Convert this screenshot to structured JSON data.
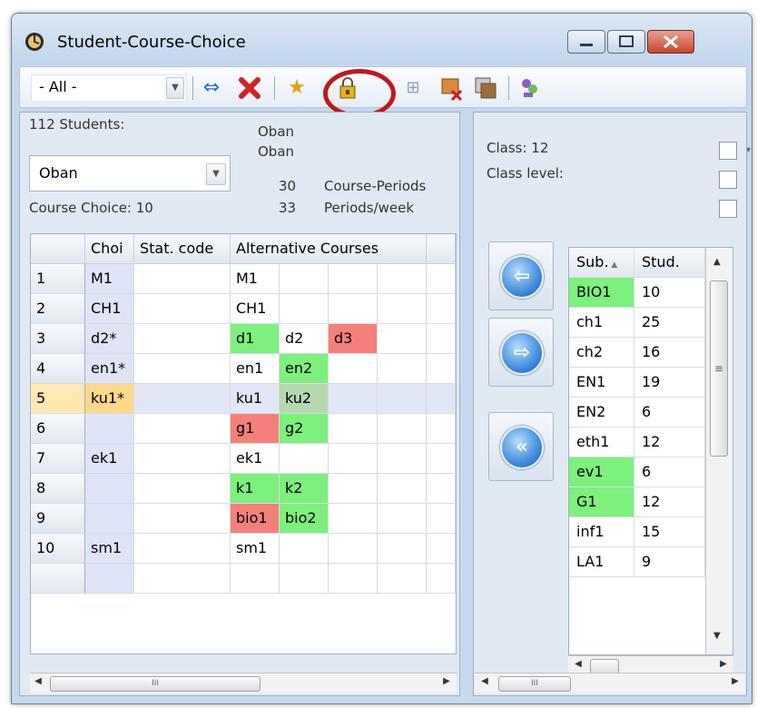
{
  "window": {
    "title": "Student-Course-Choice"
  },
  "toolbar": {
    "filter_value": "- All -",
    "icons": [
      "swap-arrows-icon",
      "delete-x-icon",
      "star-icon",
      "lock-icon",
      "grid-move-icon",
      "remove-course-icon",
      "copy-icon",
      "users-icon"
    ]
  },
  "left": {
    "students_label": "112 Students:",
    "student_name_1": "Oban",
    "student_name_2": "Oban",
    "student_value": "Oban",
    "course_periods_num": "30",
    "course_periods_label": "Course-Periods",
    "course_choice_label": "Course Choice: 10",
    "periods_week_num": "33",
    "periods_week_label": "Periods/week",
    "headers": {
      "choice": "Choi",
      "stat": "Stat. code",
      "alt": "Alternative Courses"
    },
    "rows": [
      {
        "num": "1",
        "choice": "M1",
        "alt": [
          "M1",
          "",
          "",
          ""
        ]
      },
      {
        "num": "2",
        "choice": "CH1",
        "alt": [
          "CH1",
          "",
          "",
          ""
        ]
      },
      {
        "num": "3",
        "choice": "d2*",
        "alt": [
          "d1",
          "d2",
          "d3",
          ""
        ]
      },
      {
        "num": "4",
        "choice": "en1*",
        "alt": [
          "en1",
          "en2",
          "",
          ""
        ]
      },
      {
        "num": "5",
        "choice": "ku1*",
        "alt": [
          "ku1",
          "ku2",
          "",
          ""
        ]
      },
      {
        "num": "6",
        "choice": "",
        "alt": [
          "g1",
          "g2",
          "",
          ""
        ]
      },
      {
        "num": "7",
        "choice": "ek1",
        "alt": [
          "ek1",
          "",
          "",
          ""
        ]
      },
      {
        "num": "8",
        "choice": "",
        "alt": [
          "k1",
          "k2",
          "",
          ""
        ]
      },
      {
        "num": "9",
        "choice": "",
        "alt": [
          "bio1",
          "bio2",
          "",
          ""
        ]
      },
      {
        "num": "10",
        "choice": "sm1",
        "alt": [
          "sm1",
          "",
          "",
          ""
        ]
      },
      {
        "num": "",
        "choice": "",
        "alt": [
          "",
          "",
          "",
          ""
        ]
      }
    ],
    "scroll_thumb": "III"
  },
  "right": {
    "class_label": "Class: 12",
    "class_level_label": "Class level:",
    "headers": {
      "sub": "Sub.",
      "stud": "Stud."
    },
    "rows": [
      {
        "sub": "BIO1",
        "stud": "10"
      },
      {
        "sub": "ch1",
        "stud": "25"
      },
      {
        "sub": "ch2",
        "stud": "16"
      },
      {
        "sub": "EN1",
        "stud": "19"
      },
      {
        "sub": "EN2",
        "stud": "6"
      },
      {
        "sub": "eth1",
        "stud": "12"
      },
      {
        "sub": "ev1",
        "stud": "6"
      },
      {
        "sub": "G1",
        "stud": "12"
      },
      {
        "sub": "inf1",
        "stud": "15"
      },
      {
        "sub": "LA1",
        "stud": "9"
      }
    ],
    "scroll_thumb": "III",
    "vscroll_thumb": "≡"
  },
  "colors": {
    "green": "#7df07d",
    "red": "#f5807a",
    "highlight_ring": "#c0181b"
  }
}
